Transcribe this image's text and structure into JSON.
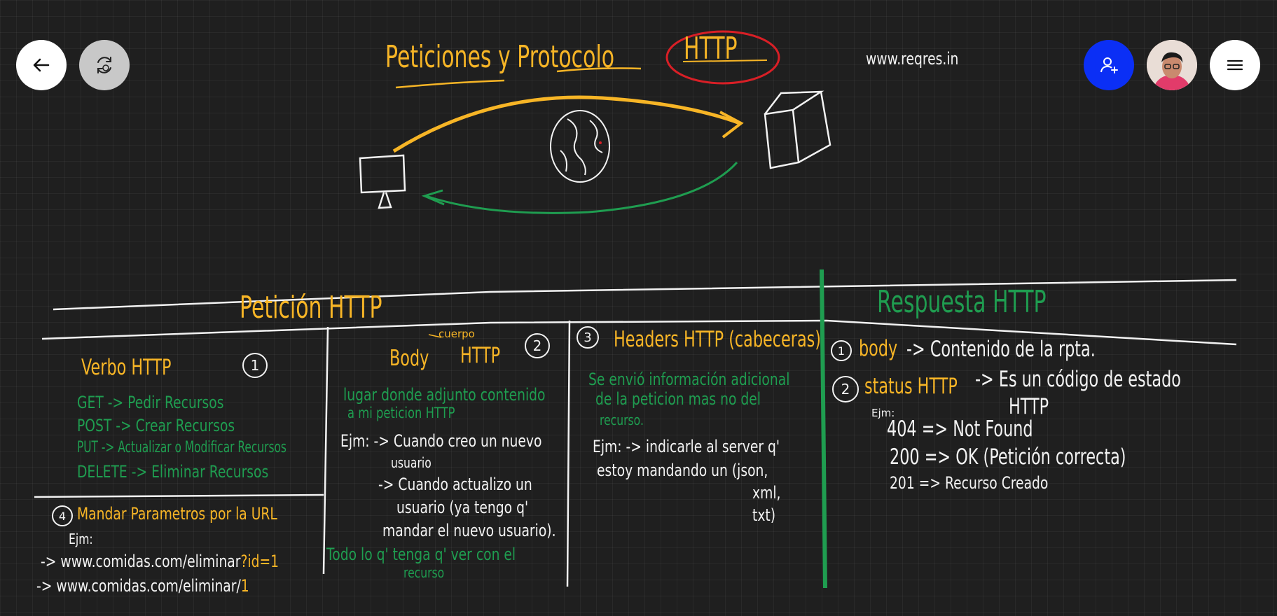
{
  "title": {
    "part1": "Peticiones y Protocolo",
    "part2": "HTTP"
  },
  "url_top": "www.reqres.in",
  "toolbar": {
    "back_icon": "arrow-left-icon",
    "history_icon": "history-restore-icon",
    "invite_icon": "add-user-icon",
    "menu_icon": "hamburger-menu-icon",
    "invite_color": "#0b2ff5"
  },
  "request": {
    "heading": "Petición HTTP",
    "verbs": {
      "heading": "Verbo HTTP",
      "num": "1",
      "items": [
        "GET -> Pedir Recursos",
        "POST -> Crear Recursos",
        "PUT -> Actualizar o Modificar Recursos",
        "DELETE -> Eliminar Recursos"
      ]
    },
    "body": {
      "heading": "Body",
      "num": "2",
      "heading2": "HTTP",
      "note": "cuerpo",
      "desc1": "lugar donde adjunto contenido",
      "desc2": "a mi peticion HTTP",
      "ex1": "Ejm: -> Cuando creo un nuevo",
      "ex2": "usuario",
      "ex3": "-> Cuando actualizo un",
      "ex4": "usuario (ya tengo q'",
      "ex5": "mandar el nuevo usuario).",
      "summary1": "Todo lo q' tenga q' ver con el",
      "summary2": "recurso"
    },
    "headers": {
      "num": "3",
      "heading": "Headers HTTP (cabeceras)",
      "desc1": "Se envió información adicional",
      "desc2": "de la peticion mas no del",
      "desc3": "recurso.",
      "ex1": "Ejm: -> indicarle al server q'",
      "ex2": "estoy mandando un (json,",
      "ex3": "xml,",
      "ex4": "txt)"
    },
    "params": {
      "num": "4",
      "heading": "Mandar Parametros por la URL",
      "ej": "Ejm:",
      "url1a": "-> www.comidas.com/eliminar",
      "url1b": "?id=1",
      "url2a": "-> www.comidas.com/eliminar/",
      "url2b": "1"
    }
  },
  "response": {
    "heading": "Respuesta HTTP",
    "n1": "1",
    "body_label": "body",
    "body_desc": "-> Contenido de la rpta.",
    "n2": "2",
    "status_label": "status HTTP",
    "status_desc": "-> Es un código de estado",
    "status_desc2": "HTTP",
    "ejm": "Ejm:",
    "codes": [
      "404 => Not Found",
      "200 => OK (Petición correcta)",
      "201 => Recurso Creado"
    ]
  }
}
